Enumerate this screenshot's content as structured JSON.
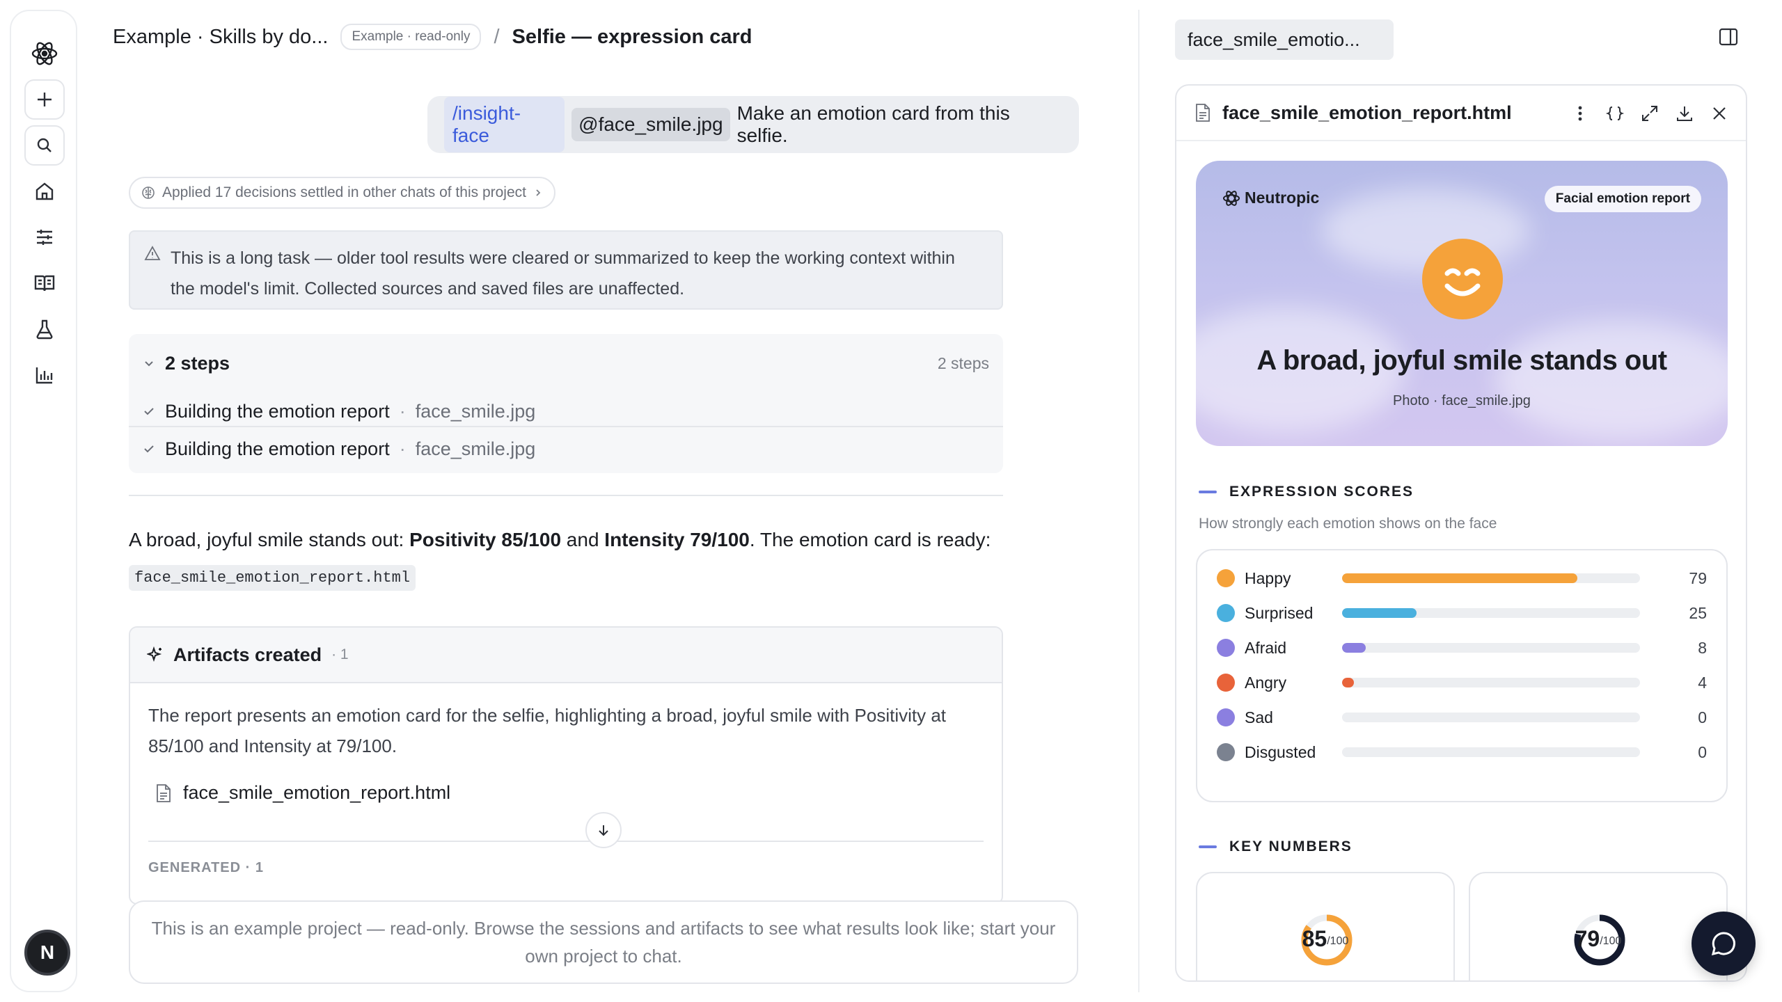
{
  "header": {
    "project": "Example · Skills by do...",
    "badge": "Example · read-only",
    "separator": "/",
    "title": "Selfie — expression card"
  },
  "user_message": {
    "command": "/insight-face",
    "file": "@face_smile.jpg",
    "text": "Make an emotion card from this selfie."
  },
  "applied_pill": "Applied 17 decisions settled in other chats of this project",
  "notice": "This is a long task — older tool results were cleared or summarized to keep the working context within the model's limit. Collected sources and saved files are unaffected.",
  "steps": {
    "title": "2 steps",
    "count": "2 steps",
    "items": [
      {
        "label": "Building the emotion report",
        "sep": "·",
        "sub": "face_smile.jpg"
      },
      {
        "label": "Building the emotion report",
        "sep": "·",
        "sub": "face_smile.jpg"
      }
    ]
  },
  "answer": {
    "lead": "A broad, joyful smile stands out: ",
    "pos": "Positivity 85/100",
    "and": " and ",
    "int": "Intensity 79/100",
    "tail": ". The emotion card is ready:",
    "code": "face_smile_emotion_report.html"
  },
  "artifacts": {
    "title": "Artifacts created",
    "count": "· 1",
    "summary": "The report presents an emotion card for the selfie, highlighting a broad, joyful smile with Positivity at 85/100 and Intensity at 79/100.",
    "file": "face_smile_emotion_report.html",
    "generated": "GENERATED · 1"
  },
  "composer": "This is an example project — read-only. Browse the sessions and artifacts to see what results look like; start your own project to chat.",
  "right": {
    "tab": "face_smile_emotio...",
    "viewer_title": "face_smile_emotion_report.html",
    "hero": {
      "brand": "Neutropic",
      "tag": "Facial emotion report",
      "title": "A broad, joyful smile stands out",
      "sub": "Photo · face_smile.jpg"
    },
    "scores_title": "EXPRESSION SCORES",
    "scores_sub": "How strongly each emotion shows on the face",
    "scores": [
      {
        "label": "Happy",
        "value": "79",
        "pct": 79,
        "color": "#f5a23a"
      },
      {
        "label": "Surprised",
        "value": "25",
        "pct": 25,
        "color": "#4ab0de"
      },
      {
        "label": "Afraid",
        "value": "8",
        "pct": 8,
        "color": "#8b7fe0"
      },
      {
        "label": "Angry",
        "value": "4",
        "pct": 4,
        "color": "#e8633a"
      },
      {
        "label": "Sad",
        "value": "0",
        "pct": 0,
        "color": "#8b7fe0"
      },
      {
        "label": "Disgusted",
        "value": "0",
        "pct": 0,
        "color": "#7b8290"
      }
    ],
    "key_title": "KEY NUMBERS",
    "key_numbers": [
      {
        "value": "85",
        "unit": "/100",
        "pct": 85,
        "color": "#f5a23a"
      },
      {
        "value": "79",
        "unit": "/100",
        "pct": 79,
        "color": "#141a2e"
      }
    ]
  },
  "avatar": "N"
}
